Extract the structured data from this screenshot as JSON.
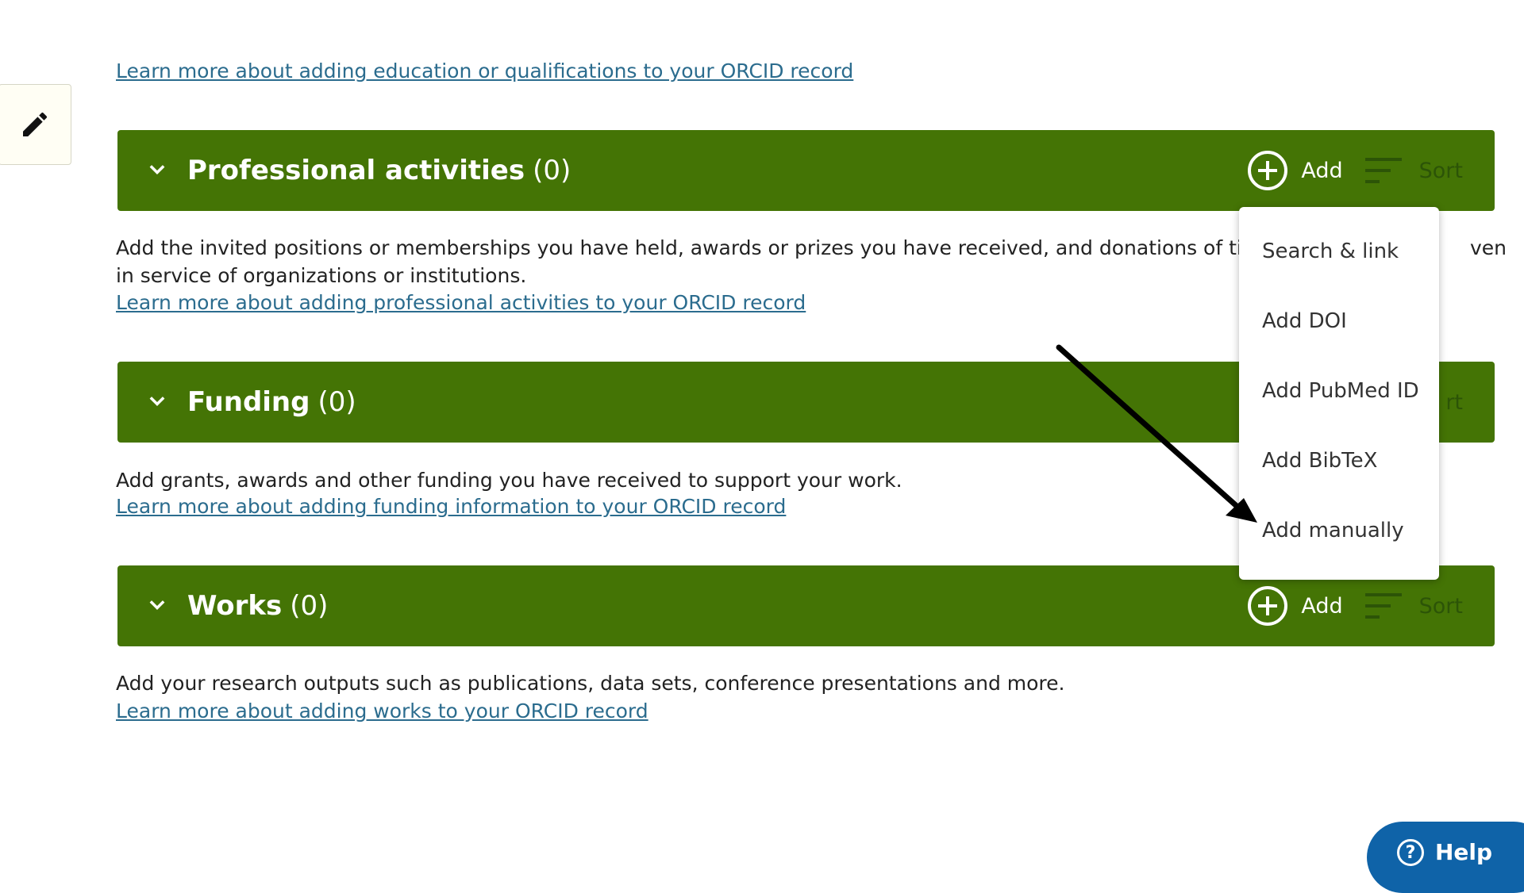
{
  "education": {
    "learn_more": "Learn more about adding education or qualifications to your ORCID record"
  },
  "professional": {
    "title": "Professional activities",
    "count": "(0)",
    "add_label": "Add",
    "sort_label": "Sort",
    "desc_line1": "Add the invited positions or memberships you have held, awards or prizes you have received, and donations of ti",
    "desc_line1_tail": "ven",
    "desc_line2": "in service of organizations or institutions.",
    "learn_more": "Learn more about adding professional activities to your ORCID record"
  },
  "funding": {
    "title": "Funding",
    "count": "(0)",
    "sort_partial": "rt",
    "desc": "Add grants, awards and other funding you have received to support your work.",
    "learn_more": "Learn more about adding funding information to your ORCID record"
  },
  "works": {
    "title": "Works",
    "count": "(0)",
    "add_label": "Add",
    "sort_label": "Sort",
    "desc": "Add your research outputs such as publications, data sets, conference presentations and more.",
    "learn_more": "Learn more about adding works to your ORCID record"
  },
  "add_menu": {
    "items": [
      "Search & link",
      "Add DOI",
      "Add PubMed ID",
      "Add BibTeX",
      "Add manually"
    ]
  },
  "help": {
    "label": "Help"
  },
  "icons": {
    "edit": "pencil-icon",
    "expand": "chevron-down-icon",
    "add": "plus-circle-icon",
    "sort": "sort-lines-icon",
    "help": "question-circle-icon"
  },
  "colors": {
    "section_green": "#447405",
    "link_blue": "#2b6c8e",
    "help_blue": "#0f63a8"
  }
}
